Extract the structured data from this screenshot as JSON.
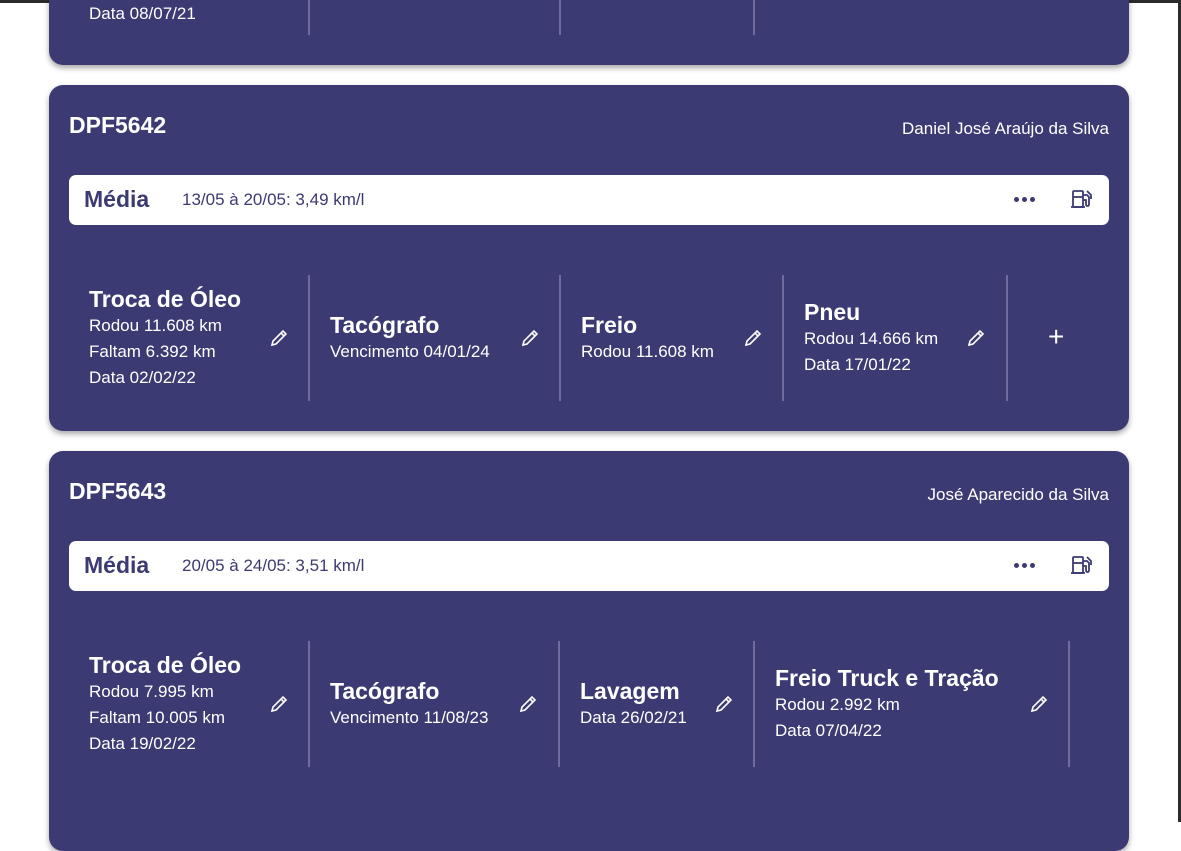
{
  "top_card": {
    "partial_line": "Data 08/07/21"
  },
  "vehicles": [
    {
      "plate": "DPF5642",
      "driver": "Daniel José Araújo da Silva",
      "media": {
        "label": "Média",
        "value": "13/05 à 20/05: 3,49 km/l"
      },
      "items": [
        {
          "title": "Troca de Óleo",
          "lines": [
            "Rodou 11.608 km",
            "Faltam 6.392 km",
            "Data 02/02/22"
          ]
        },
        {
          "title": "Tacógrafo",
          "lines": [
            "Vencimento 04/01/24"
          ]
        },
        {
          "title": "Freio",
          "lines": [
            "Rodou 11.608 km"
          ]
        },
        {
          "title": "Pneu",
          "lines": [
            "Rodou 14.666 km",
            "Data 17/01/22"
          ]
        }
      ],
      "add_label": "+"
    },
    {
      "plate": "DPF5643",
      "driver": "José Aparecido da Silva",
      "media": {
        "label": "Média",
        "value": "20/05 à 24/05: 3,51 km/l"
      },
      "items": [
        {
          "title": "Troca de Óleo",
          "lines": [
            "Rodou 7.995 km",
            "Faltam 10.005 km",
            "Data 19/02/22"
          ]
        },
        {
          "title": "Tacógrafo",
          "lines": [
            "Vencimento 11/08/23"
          ]
        },
        {
          "title": "Lavagem",
          "lines": [
            "Data 26/02/21"
          ]
        },
        {
          "title": "Freio Truck e Tração",
          "lines": [
            "Rodou 2.992 km",
            "Data 07/04/22"
          ]
        }
      ]
    }
  ],
  "icons": {
    "more": "more-horizontal-icon",
    "fuel": "fuel-pump-icon",
    "edit": "pencil-icon",
    "add": "plus-icon"
  },
  "colors": {
    "card_bg": "#3c3a72",
    "bar_bg": "#ffffff",
    "separator": "#6e6c9c"
  }
}
